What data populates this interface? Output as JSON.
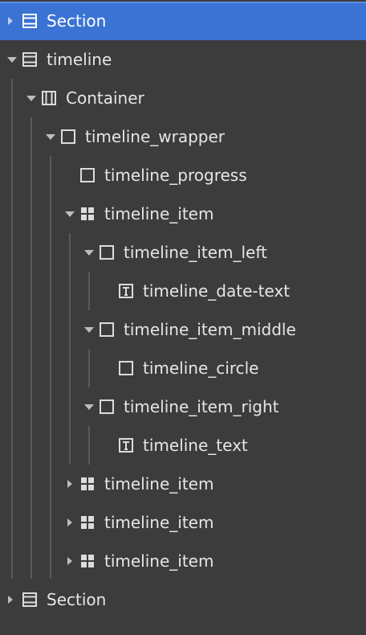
{
  "navigator": {
    "rows": [
      {
        "label": "Section",
        "icon": "section-icon",
        "caret": "collapsed",
        "selected": true
      },
      {
        "label": "timeline",
        "icon": "section-icon",
        "caret": "expanded"
      },
      {
        "label": "Container",
        "icon": "container-icon",
        "caret": "expanded"
      },
      {
        "label": "timeline_wrapper",
        "icon": "div-block-icon",
        "caret": "expanded"
      },
      {
        "label": "timeline_progress",
        "icon": "div-block-icon",
        "caret": "none"
      },
      {
        "label": "timeline_item",
        "icon": "grid-icon",
        "caret": "expanded"
      },
      {
        "label": "timeline_item_left",
        "icon": "div-block-icon",
        "caret": "expanded"
      },
      {
        "label": "timeline_date-text",
        "icon": "text-block-icon",
        "caret": "none"
      },
      {
        "label": "timeline_item_middle",
        "icon": "div-block-icon",
        "caret": "expanded"
      },
      {
        "label": "timeline_circle",
        "icon": "div-block-icon",
        "caret": "none"
      },
      {
        "label": "timeline_item_right",
        "icon": "div-block-icon",
        "caret": "expanded"
      },
      {
        "label": "timeline_text",
        "icon": "text-block-icon",
        "caret": "none"
      },
      {
        "label": "timeline_item",
        "icon": "grid-icon",
        "caret": "collapsed"
      },
      {
        "label": "timeline_item",
        "icon": "grid-icon",
        "caret": "collapsed"
      },
      {
        "label": "timeline_item",
        "icon": "grid-icon",
        "caret": "collapsed"
      },
      {
        "label": "Section",
        "icon": "section-icon",
        "caret": "collapsed"
      }
    ]
  },
  "colors": {
    "background": "#3c3c3c",
    "selected": "#3b73d4",
    "text": "#e6e6e6",
    "icon": "#dcdcdc",
    "guide": "#5a5a5a"
  }
}
